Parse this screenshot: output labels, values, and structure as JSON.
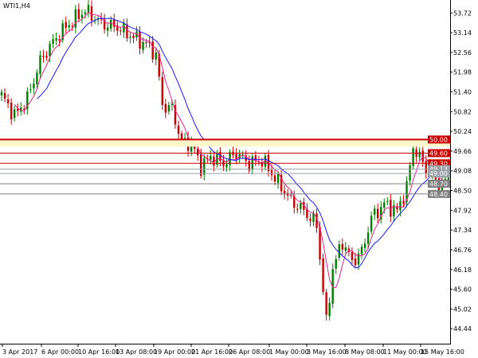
{
  "chart_data": {
    "type": "candlestick",
    "title": "WTI1,H4",
    "ylim": [
      44.0,
      54.1
    ],
    "yticks": [
      "53.72",
      "53.14",
      "52.56",
      "51.98",
      "51.40",
      "50.82",
      "50.24",
      "49.66",
      "49.08",
      "48.50",
      "47.92",
      "47.34",
      "46.76",
      "46.18",
      "45.60",
      "45.02",
      "44.44"
    ],
    "xticks": [
      "3 Apr 2017",
      "6 Apr 00:00",
      "10 Apr 16:00",
      "13 Apr 08:00",
      "19 Apr 00:00",
      "21 Apr 16:00",
      "26 Apr 08:00",
      "1 May 00:00",
      "3 May 16:00",
      "8 May 08:00",
      "11 May 00:00",
      "15 May 16:00"
    ],
    "levels": [
      {
        "label": "50.00",
        "value": 50.0,
        "color": "#cc0000",
        "band": true
      },
      {
        "label": "49.60",
        "value": 49.6,
        "color": "#cc0000",
        "band": false
      },
      {
        "label": "49.30",
        "value": 49.3,
        "color": "#cc0000",
        "band": false
      },
      {
        "label": "49.13",
        "value": 49.13,
        "color": "#9aa1a8",
        "band": false
      },
      {
        "label": "49.00",
        "value": 49.0,
        "color": "#9aa1a8",
        "band": false
      },
      {
        "label": "48.70",
        "value": 48.7,
        "color": "#808080",
        "band": false
      },
      {
        "label": "48.40",
        "value": 48.4,
        "color": "#808080",
        "band": false
      }
    ],
    "waypoints": [
      [
        0,
        51.3
      ],
      [
        4,
        50.7
      ],
      [
        8,
        51.2
      ],
      [
        12,
        52.3
      ],
      [
        17,
        53.0
      ],
      [
        21,
        53.4
      ],
      [
        26,
        53.8
      ],
      [
        31,
        53.4
      ],
      [
        36,
        53.3
      ],
      [
        41,
        53.0
      ],
      [
        45,
        52.8
      ],
      [
        48,
        52.5
      ],
      [
        50,
        51.0
      ],
      [
        53,
        50.9
      ],
      [
        56,
        49.9
      ],
      [
        59,
        49.9
      ],
      [
        62,
        49.2
      ],
      [
        65,
        49.5
      ],
      [
        69,
        49.3
      ],
      [
        73,
        49.6
      ],
      [
        77,
        49.3
      ],
      [
        81,
        49.4
      ],
      [
        84,
        49.0
      ],
      [
        87,
        48.6
      ],
      [
        90,
        48.2
      ],
      [
        94,
        47.9
      ],
      [
        98,
        47.5
      ],
      [
        101,
        44.6
      ],
      [
        103,
        46.2
      ],
      [
        106,
        47.0
      ],
      [
        109,
        46.4
      ],
      [
        112,
        46.7
      ],
      [
        115,
        47.7
      ],
      [
        119,
        48.1
      ],
      [
        123,
        47.9
      ],
      [
        126,
        48.6
      ],
      [
        128,
        49.8
      ],
      [
        131,
        49.3
      ],
      [
        134,
        48.9
      ],
      [
        137,
        48.6
      ],
      [
        139,
        49.0
      ]
    ],
    "ma_fast_color": "#e8218c",
    "ma_slow_color": "#1a1aff",
    "bull_color": "#008000",
    "bear_color": "#cc0000"
  }
}
